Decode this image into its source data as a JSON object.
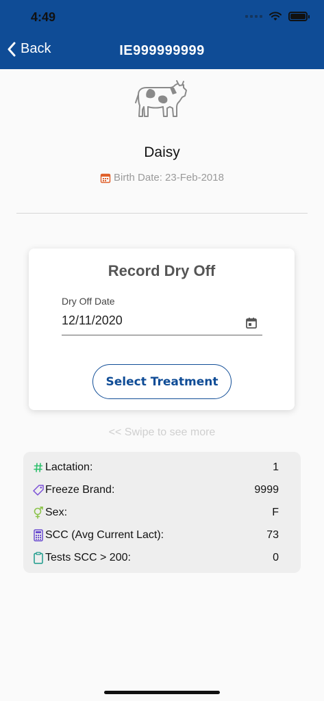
{
  "status_bar": {
    "time": "4:49"
  },
  "nav": {
    "back_label": "Back",
    "title": "IE999999999"
  },
  "animal": {
    "name": "Daisy",
    "birth_date": "Birth Date: 23-Feb-2018"
  },
  "dry_off_card": {
    "title": "Record Dry Off",
    "date_label": "Dry Off Date",
    "date_value": "12/11/2020",
    "treatment_button": "Select Treatment"
  },
  "swipe_hint": "<< Swipe to see more",
  "info_rows": [
    {
      "icon": "hash-icon",
      "label": "Lactation:",
      "value": "1",
      "color": "#2bbf6a"
    },
    {
      "icon": "tag-icon",
      "label": "Freeze Brand:",
      "value": "9999",
      "color": "#7a4fd6"
    },
    {
      "icon": "gender-icon",
      "label": "Sex:",
      "value": "F",
      "color": "#8bc34a"
    },
    {
      "icon": "calculator-icon",
      "label": "SCC (Avg Current Lact):",
      "value": "73",
      "color": "#6a4ccf"
    },
    {
      "icon": "clipboard-icon",
      "label": "Tests SCC > 200:",
      "value": "0",
      "color": "#1a9a8a"
    }
  ],
  "colors": {
    "header": "#0f4c96",
    "accent": "#0f4c96",
    "birth_icon": "#e0602a"
  }
}
